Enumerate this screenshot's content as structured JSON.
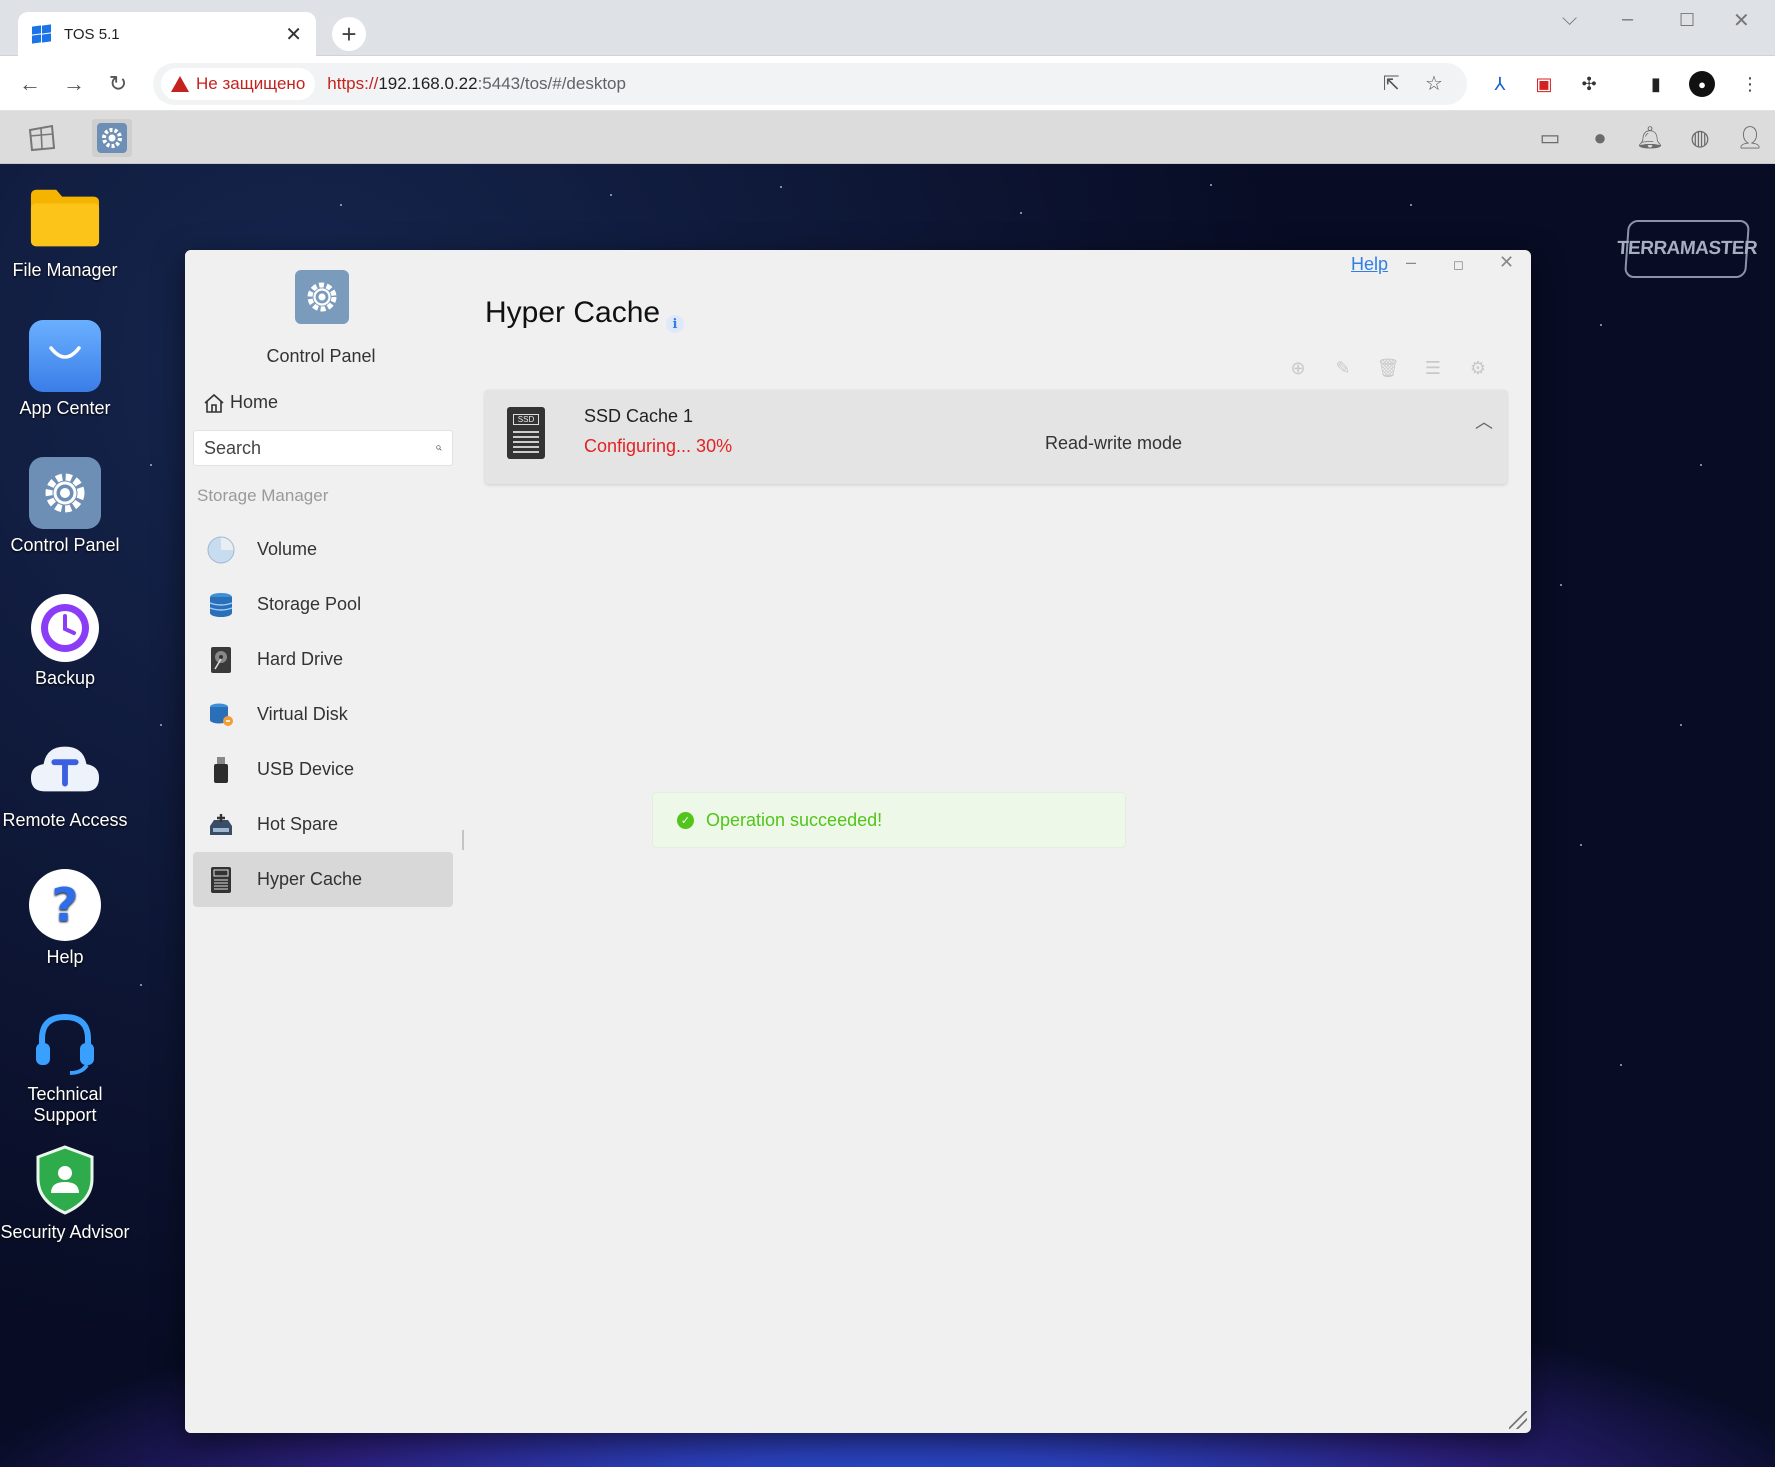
{
  "browser": {
    "tab_title": "TOS 5.1",
    "security_label": "Не защищено",
    "url_scheme": "https://",
    "url_host": "192.168.0.22",
    "url_rest": ":5443/tos/#/desktop"
  },
  "desktop": {
    "icons": [
      {
        "label": "File Manager"
      },
      {
        "label": "App Center"
      },
      {
        "label": "Control Panel"
      },
      {
        "label": "Backup"
      },
      {
        "label": "Remote Access"
      },
      {
        "label": "Help"
      },
      {
        "label": "Technical Support"
      },
      {
        "label": "Security Advisor"
      }
    ],
    "brand": "TERRAMASTER"
  },
  "window": {
    "help_link": "Help",
    "sidebar": {
      "app_title": "Control Panel",
      "home": "Home",
      "search_placeholder": "Search",
      "section": "Storage Manager",
      "items": [
        {
          "label": "Volume",
          "icon": "volume-pie-icon"
        },
        {
          "label": "Storage Pool",
          "icon": "storage-pool-icon"
        },
        {
          "label": "Hard Drive",
          "icon": "hard-drive-icon"
        },
        {
          "label": "Virtual Disk",
          "icon": "virtual-disk-icon"
        },
        {
          "label": "USB Device",
          "icon": "usb-icon"
        },
        {
          "label": "Hot Spare",
          "icon": "hot-spare-icon"
        },
        {
          "label": "Hyper Cache",
          "icon": "ssd-icon",
          "active": true
        }
      ]
    },
    "main": {
      "title": "Hyper Cache",
      "cache": {
        "name": "SSD Cache 1",
        "status": "Configuring... 30%",
        "mode": "Read-write mode",
        "icon_label": "SSD"
      },
      "toast": "Operation succeeded!"
    }
  },
  "colors": {
    "accent": "#2f7fe5",
    "status_error": "#e32222",
    "success": "#52c41a"
  }
}
